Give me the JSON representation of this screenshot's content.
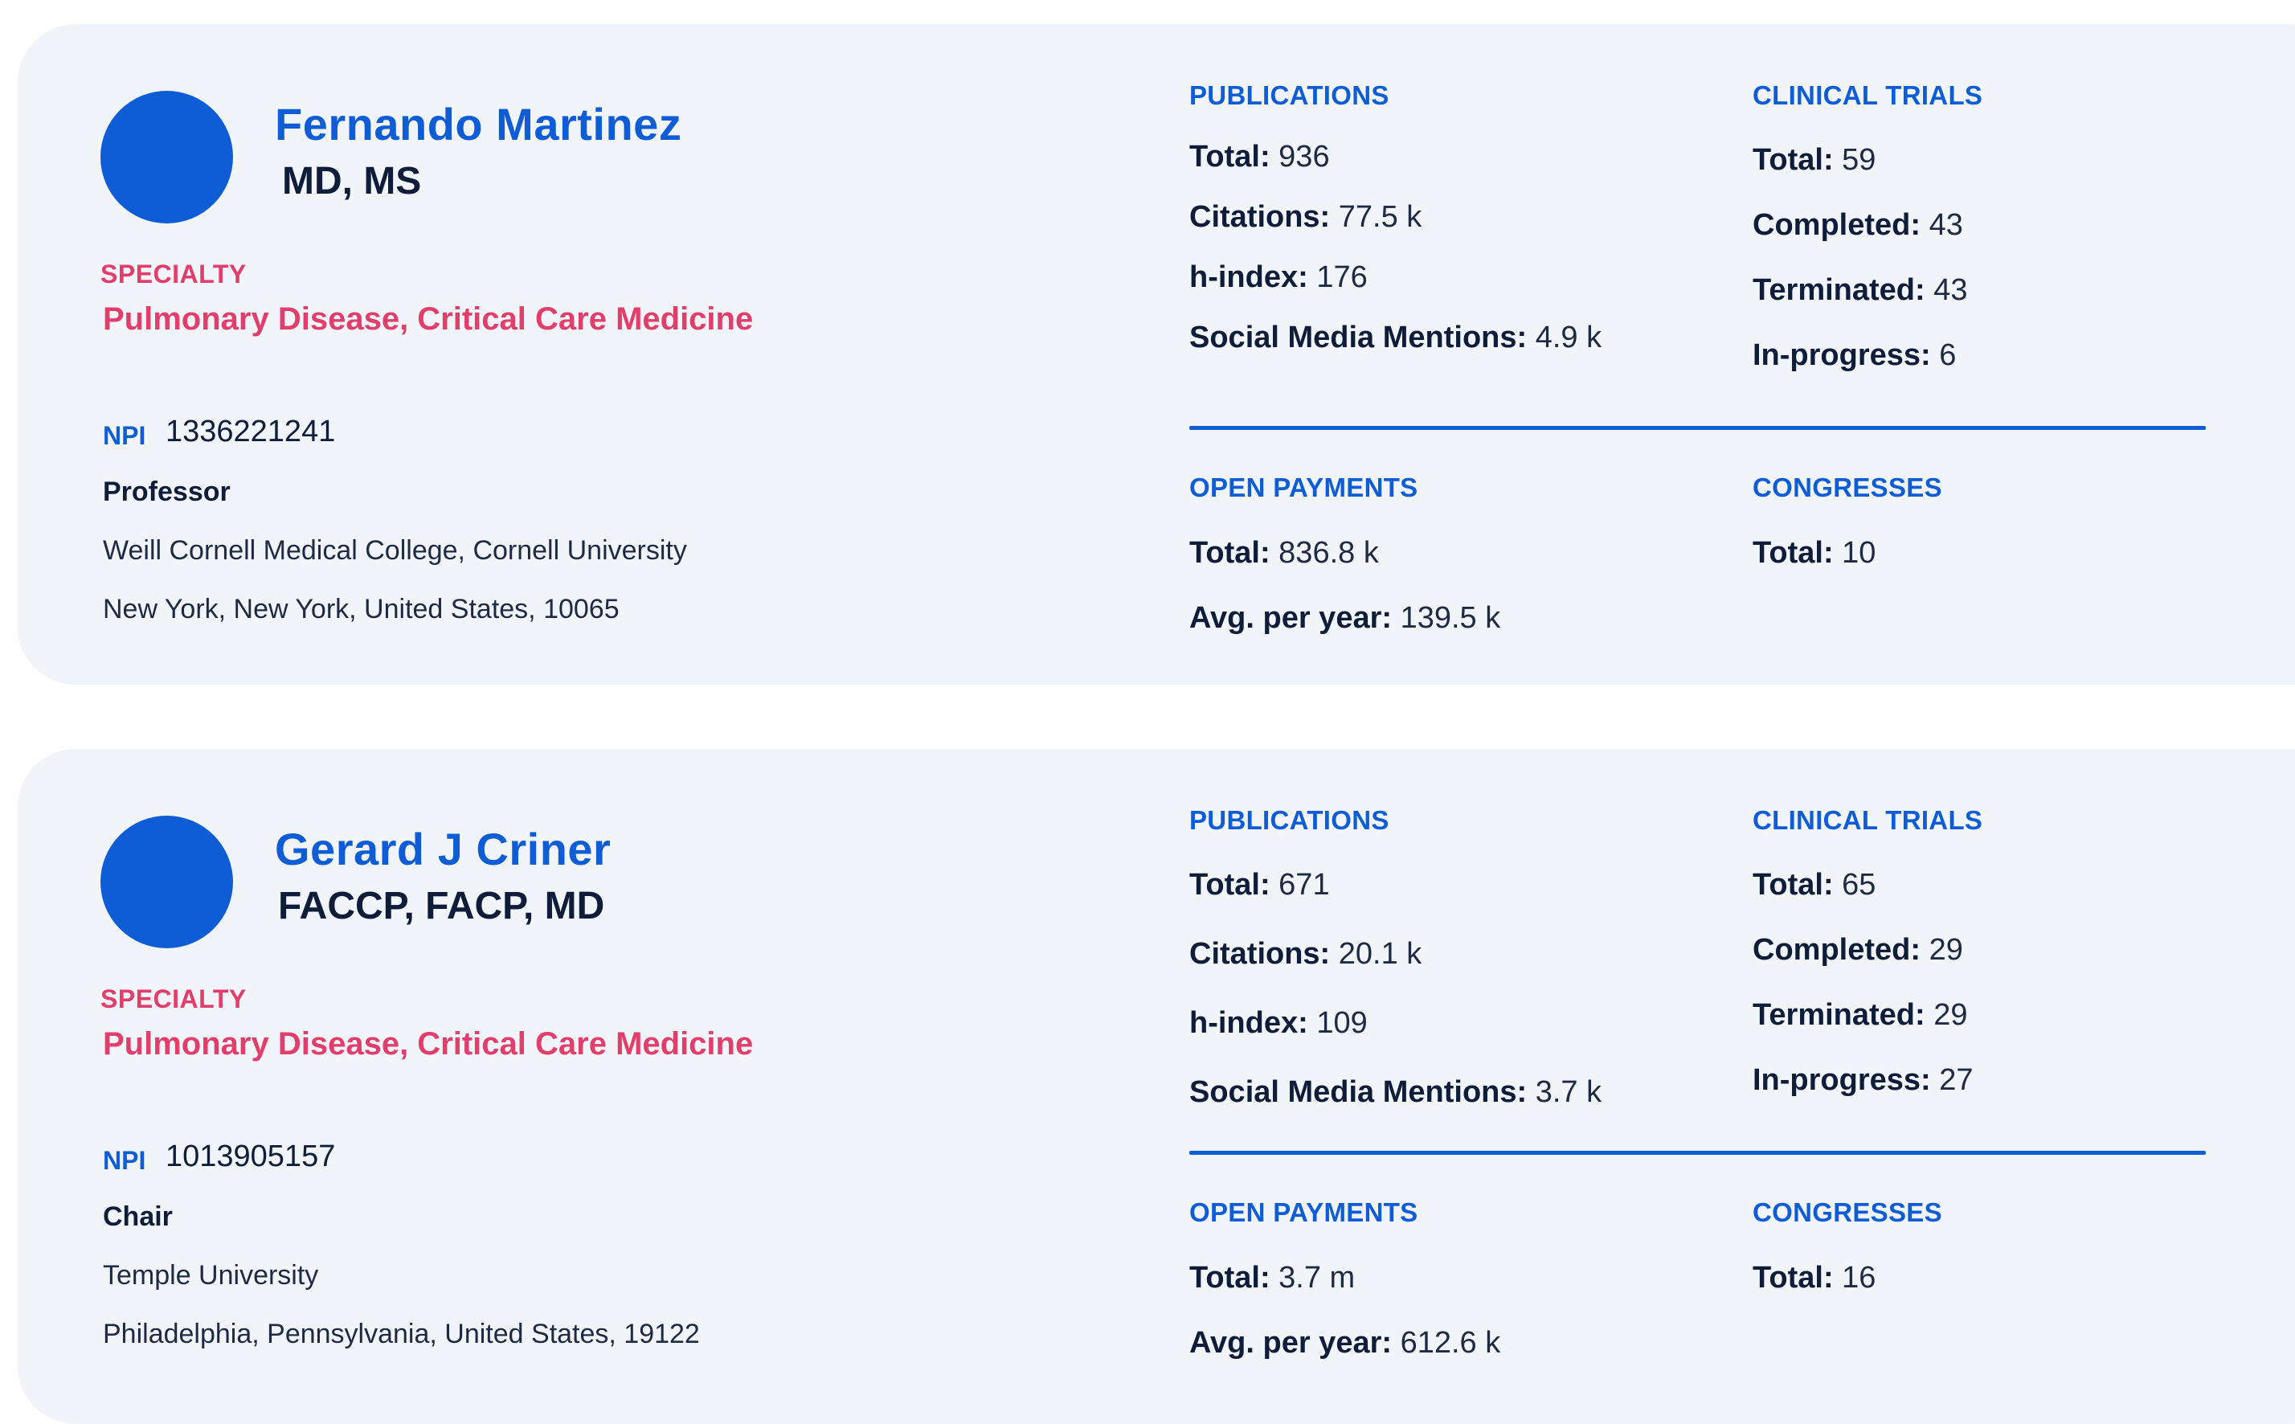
{
  "profiles": [
    {
      "name": "Fernando Martinez",
      "credentials": "MD, MS",
      "specialty_label": "SPECIALTY",
      "specialty": "Pulmonary Disease, Critical Care Medicine",
      "npi_label": "NPI",
      "npi": "1336221241",
      "role": "Professor",
      "institution": "Weill Cornell Medical College, Cornell University",
      "address": "New York, New York, United States, 10065",
      "avatar_color": "#0e5dd6",
      "publications": {
        "heading": "PUBLICATIONS",
        "total_label": "Total:",
        "total": "936",
        "citations_label": "Citations:",
        "citations": "77.5 k",
        "hindex_label": "h-index:",
        "hindex": "176",
        "social_label": "Social Media Mentions:",
        "social": "4.9 k"
      },
      "clinical_trials": {
        "heading": "CLINICAL TRIALS",
        "total_label": "Total:",
        "total": "59",
        "completed_label": "Completed:",
        "completed": "43",
        "terminated_label": "Terminated:",
        "terminated": "43",
        "inprogress_label": "In-progress:",
        "inprogress": "6"
      },
      "open_payments": {
        "heading": "OPEN PAYMENTS",
        "total_label": "Total:",
        "total": "836.8 k",
        "avg_label": "Avg. per year:",
        "avg": "139.5 k"
      },
      "congresses": {
        "heading": "CONGRESSES",
        "total_label": "Total:",
        "total": "10"
      }
    },
    {
      "name": "Gerard J Criner",
      "credentials": "FACCP, FACP, MD",
      "specialty_label": "SPECIALTY",
      "specialty": "Pulmonary Disease, Critical Care Medicine",
      "npi_label": "NPI",
      "npi": "1013905157",
      "role": "Chair",
      "institution": "Temple University",
      "address": "Philadelphia, Pennsylvania, United States, 19122",
      "avatar_color": "#0e5dd6",
      "publications": {
        "heading": "PUBLICATIONS",
        "total_label": "Total:",
        "total": "671",
        "citations_label": "Citations:",
        "citations": "20.1 k",
        "hindex_label": "h-index:",
        "hindex": "109",
        "social_label": "Social Media Mentions:",
        "social": "3.7 k"
      },
      "clinical_trials": {
        "heading": "CLINICAL TRIALS",
        "total_label": "Total:",
        "total": "65",
        "completed_label": "Completed:",
        "completed": "29",
        "terminated_label": "Terminated:",
        "terminated": "29",
        "inprogress_label": "In-progress:",
        "inprogress": "27"
      },
      "open_payments": {
        "heading": "OPEN PAYMENTS",
        "total_label": "Total:",
        "total": "3.7 m",
        "avg_label": "Avg. per year:",
        "avg": "612.6 k"
      },
      "congresses": {
        "heading": "CONGRESSES",
        "total_label": "Total:",
        "total": "16"
      }
    }
  ],
  "colors": {
    "accent": "#0e5dd6",
    "specialty": "#e23e6b",
    "card_bg": "#f1f5f9",
    "text": "#0f1d3a"
  }
}
